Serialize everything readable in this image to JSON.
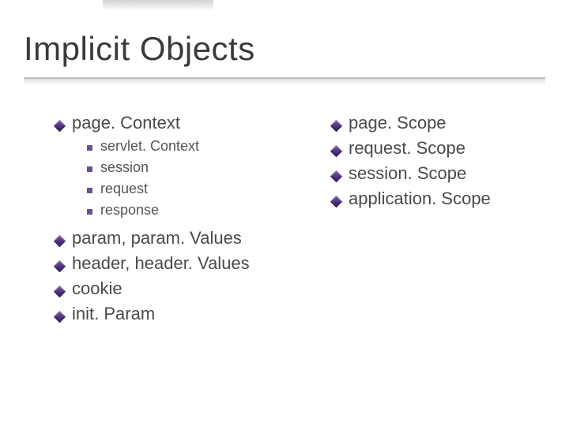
{
  "title": "Implicit Objects",
  "left": {
    "main0": "page. Context",
    "sub": [
      "servlet. Context",
      "session",
      "request",
      "response"
    ],
    "main1": "param, param. Values",
    "main2": "header, header. Values",
    "main3": "cookie",
    "main4": "init. Param"
  },
  "right": {
    "r0": "page. Scope",
    "r1": "request. Scope",
    "r2": "session. Scope",
    "r3": "application. Scope"
  }
}
